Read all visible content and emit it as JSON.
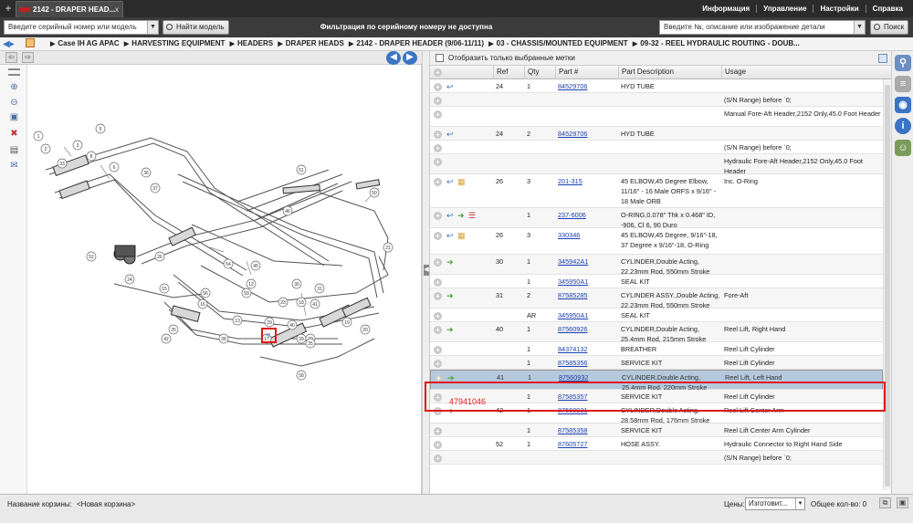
{
  "tab": {
    "title": "2142 - DRAPER HEAD...",
    "close": "x",
    "new": "+"
  },
  "top_links": [
    "Информация",
    "Управление",
    "Настройки",
    "Справка"
  ],
  "search": {
    "serial_placeholder": "Введите серийный номер или модель",
    "find_model_label": "Найти модель",
    "message": "Фильтрация по серийному номеру не доступна",
    "part_placeholder": "Введите №, описание или изображение детали",
    "search_label": "Поиск"
  },
  "breadcrumb": [
    "Case IH AG APAC",
    "HARVESTING EQUIPMENT",
    "HEADERS",
    "DRAPER HEADS",
    "2142 - DRAPER HEADER (9/06-11/11)",
    "03 - CHASSIS/MOUNTED EQUIPMENT",
    "09-32 - REEL HYDRAULIC ROUTING - DOUB..."
  ],
  "filter": {
    "label": "Отобразить только выбранные метки"
  },
  "columns": [
    "Ref",
    "Qty",
    "Part #",
    "Part Description",
    "Usage"
  ],
  "rows": [
    {
      "ref": "24",
      "qty": "1",
      "part": "84529706",
      "desc": "HYD TUBE",
      "usage": "",
      "icons": [
        "reply"
      ]
    },
    {
      "ref": "",
      "qty": "",
      "part": "",
      "desc": "",
      "usage": "(S/N Range) before `0;",
      "icons": []
    },
    {
      "ref": "",
      "qty": "",
      "part": "",
      "desc": "",
      "usage": "Manual Fore-Aft Header,2152 Only,45.0 Foot Header",
      "icons": []
    },
    {
      "ref": "24",
      "qty": "2",
      "part": "84529706",
      "desc": "HYD TUBE",
      "usage": "",
      "icons": [
        "reply"
      ]
    },
    {
      "ref": "",
      "qty": "",
      "part": "",
      "desc": "",
      "usage": "(S/N Range) before `0;",
      "icons": []
    },
    {
      "ref": "",
      "qty": "",
      "part": "",
      "desc": "",
      "usage": "Hydraulic Fore-Aft Header,2152 Only,45.0 Foot Header",
      "icons": []
    },
    {
      "ref": "26",
      "qty": "3",
      "part": "201-315",
      "desc": "45 ELBOW,45 Degree  Elbow, 11/16\" - 16 Male ORFS x 9/16\" - 18 Male ORB",
      "usage": "Inc. O-Ring",
      "icons": [
        "reply",
        "box"
      ]
    },
    {
      "ref": "",
      "qty": "1",
      "part": "237-6006",
      "desc": "O-RING,0.078\" Thk x 0.468\" ID, -906, Cl 6, 90 Duro",
      "usage": "",
      "icons": [
        "reply",
        "forward",
        "list"
      ]
    },
    {
      "ref": "26",
      "qty": "3",
      "part": "330346",
      "desc": "45 ELBOW,45 Degree, 9/16\"-18, 37 Degree x 9/16\"-18, O-Ring",
      "usage": "",
      "icons": [
        "reply",
        "box"
      ]
    },
    {
      "ref": "30",
      "qty": "1",
      "part": "345942A1",
      "desc": "CYLINDER,Double Acting, 22.23mm Rod, 550mm Stroke",
      "usage": "",
      "icons": [
        "forward"
      ]
    },
    {
      "ref": "",
      "qty": "1",
      "part": "345950A1",
      "desc": "SEAL KIT",
      "usage": "",
      "icons": []
    },
    {
      "ref": "31",
      "qty": "2",
      "part": "87585285",
      "desc": "CYLINDER ASSY.,Double Acting, 22.23mm Rod, 550mm Stroke",
      "usage": "Fore-Aft",
      "icons": [
        "forward"
      ]
    },
    {
      "ref": "",
      "qty": "AR",
      "part": "345950A1",
      "desc": "SEAL KIT",
      "usage": "",
      "icons": []
    },
    {
      "ref": "40",
      "qty": "1",
      "part": "87560926",
      "desc": "CYLINDER,Double Acting, 25.4mm Rod, 215mm Stroke",
      "usage": "Reel Lift, Right Hand",
      "icons": [
        "forward"
      ]
    },
    {
      "ref": "",
      "qty": "1",
      "part": "84374132",
      "desc": "BREATHER",
      "usage": "Reel Lift Cylinder",
      "icons": []
    },
    {
      "ref": "",
      "qty": "1",
      "part": "87585356",
      "desc": "SERVICE KIT",
      "usage": "Reel Lift Cylinder",
      "icons": []
    },
    {
      "ref": "41",
      "qty": "1",
      "part": "87560932",
      "desc": "CYLINDER,Double Acting, 25.4mm Rod, 220mm Stroke",
      "usage": "Reel Lift, Left Hand",
      "icons": [
        "forward"
      ]
    },
    {
      "ref": "",
      "qty": "1",
      "part": "87585357",
      "desc": "SERVICE KIT",
      "usage": "Reel Lift Cylinder",
      "icons": []
    },
    {
      "ref": "42",
      "qty": "1",
      "part": "87560931",
      "desc": "CYLINDER,Double Acting, 28.58mm Rod, 176mm Stroke",
      "usage": "Reel Lift Center Arm",
      "icons": [
        "forward"
      ]
    },
    {
      "ref": "",
      "qty": "1",
      "part": "87585358",
      "desc": "SERVICE KIT",
      "usage": "Reel Lift Center Arm Cylinder",
      "icons": []
    },
    {
      "ref": "52",
      "qty": "1",
      "part": "87605727",
      "desc": "HOSE ASSY.",
      "usage": "Hydraulic Connector to Right Hand Side",
      "icons": []
    },
    {
      "ref": "",
      "qty": "",
      "part": "",
      "desc": "",
      "usage": "(S/N Range) before `0;",
      "icons": []
    }
  ],
  "selected_row_annotation": "47941046",
  "diagram_callouts": [
    "1",
    "2",
    "3",
    "5",
    "6",
    "8",
    "12",
    "13",
    "15",
    "16",
    "17",
    "18",
    "19",
    "20",
    "21",
    "22",
    "23",
    "24",
    "25",
    "26",
    "28",
    "29",
    "30",
    "31",
    "33",
    "35",
    "36",
    "37",
    "39",
    "40",
    "41",
    "42",
    "45",
    "46",
    "50",
    "51",
    "52",
    "54",
    "56",
    "58",
    "59"
  ],
  "highlight_callout": "41",
  "bottom": {
    "cart_label": "Название корзины:",
    "cart_value": "<Новая корзина>",
    "price_label": "Цены:",
    "price_value": "Изготовит...",
    "total_label": "Общее кол-во: 0"
  },
  "colors": {
    "accent": "#3b74c4",
    "highlight_border": "#e01818",
    "selected_row": "#b4c9dc"
  }
}
